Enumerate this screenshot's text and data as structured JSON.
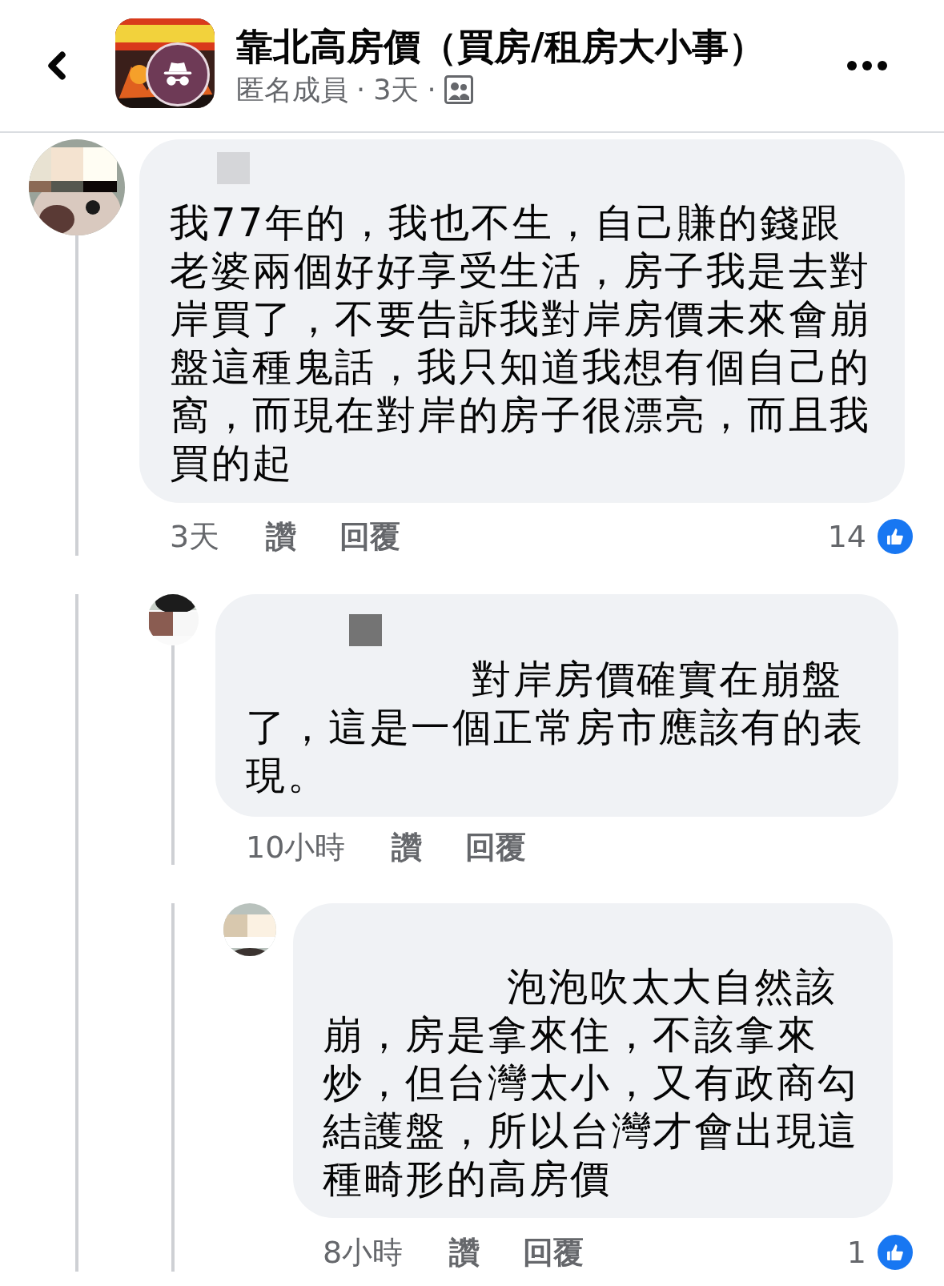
{
  "header": {
    "group_name": "靠北高房價（買房/租房大小事）",
    "meta": [
      {
        "text": "匿名成員"
      },
      {
        "text": "·"
      },
      {
        "text": "3天"
      },
      {
        "text": "·"
      }
    ]
  },
  "comments": [
    {
      "text": "我77年的，我也不生，自己賺的錢跟老婆兩個好好享受生活，房子我是去對岸買了，不要告訴我對岸房價未來會崩盤這種鬼話，我只知道我想有個自己的窩，而現在對岸的房子很漂亮，而且我買的起",
      "time": "3天",
      "like_label": "讚",
      "reply_label": "回覆",
      "reaction_count": "14",
      "children": [
        {
          "text": "對岸房價確實在崩盤了，這是一個正常房市應該有的表現。",
          "time": "10小時",
          "like_label": "讚",
          "reply_label": "回覆",
          "children": [
            {
              "text": "泡泡吹太大自然該崩，房是拿來住，不該拿來炒，但台灣太小，又有政商勾結護盤，所以台灣才會出現這種畸形的高房價",
              "time": "8小時",
              "like_label": "讚",
              "reply_label": "回覆",
              "reaction_count": "1"
            }
          ]
        }
      ]
    }
  ]
}
